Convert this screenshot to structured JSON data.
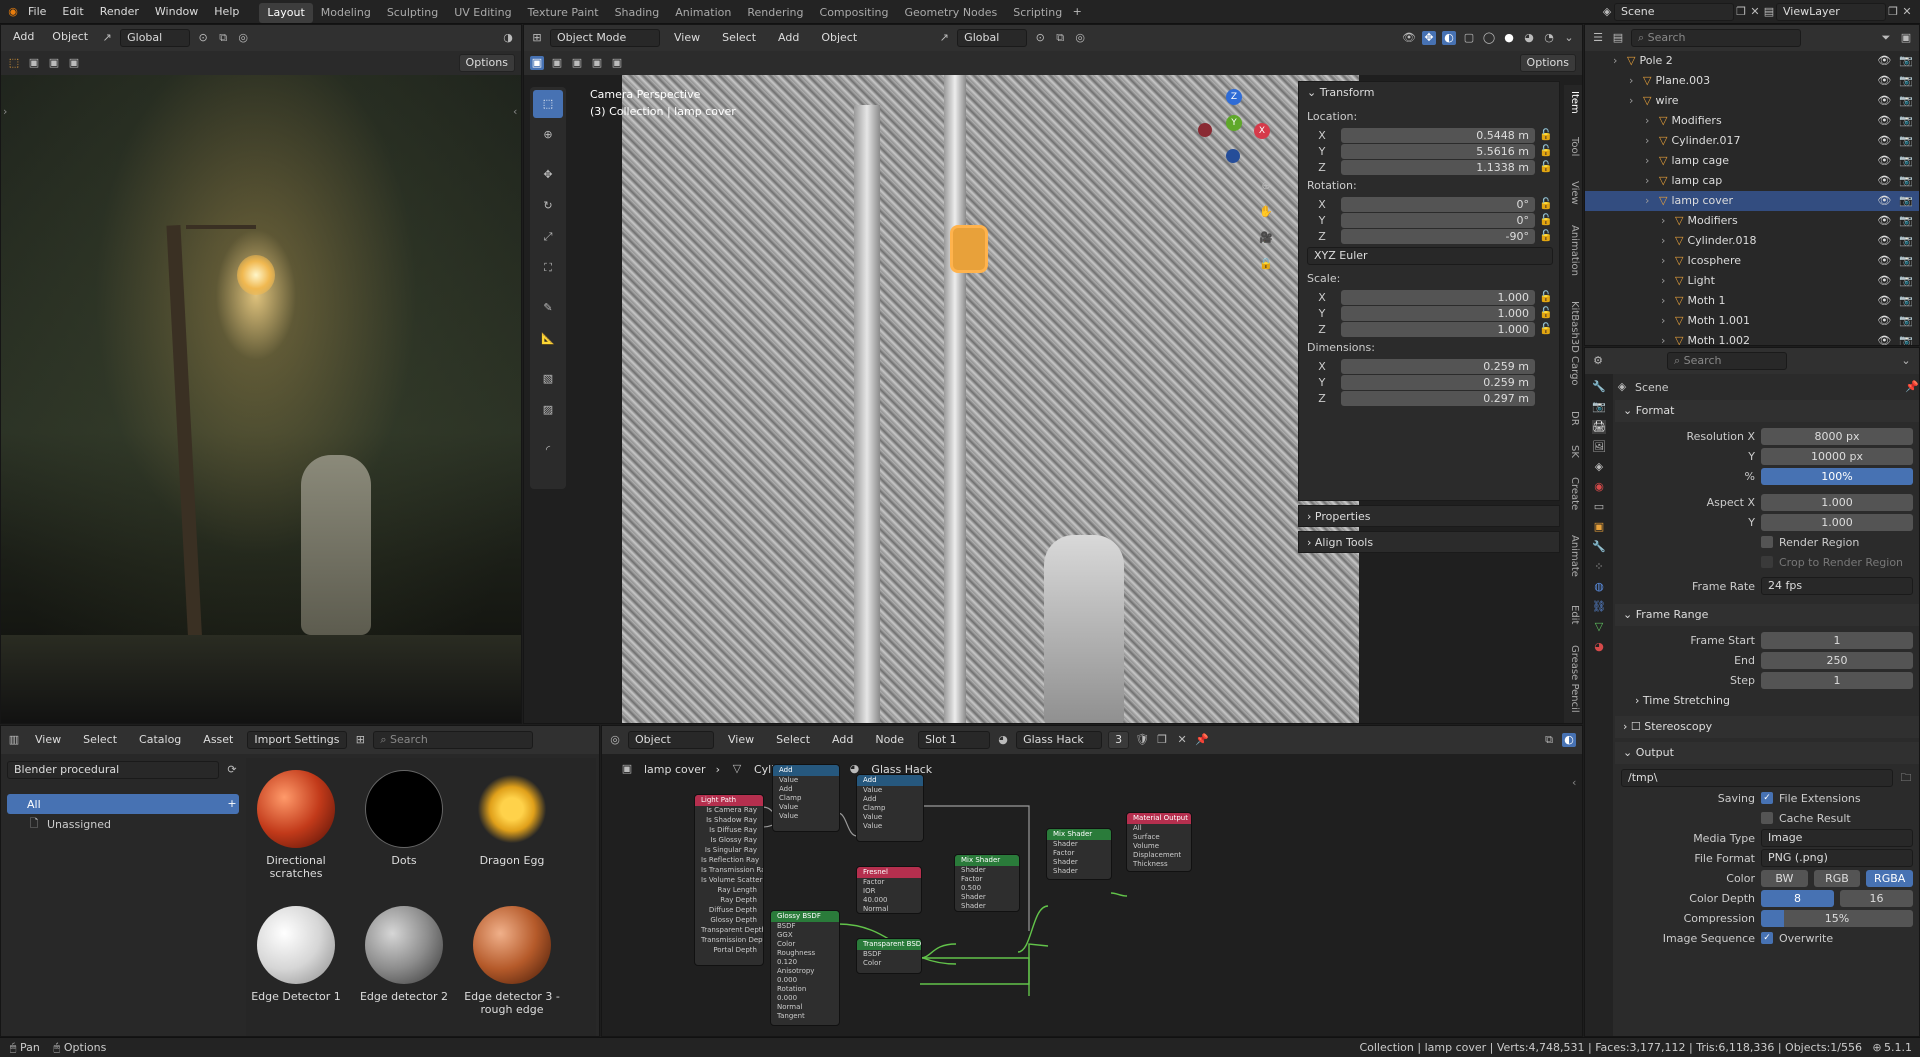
{
  "topbar": {
    "menus": [
      "File",
      "Edit",
      "Render",
      "Window",
      "Help"
    ],
    "workspaces": [
      "Layout",
      "Modeling",
      "Sculpting",
      "UV Editing",
      "Texture Paint",
      "Shading",
      "Animation",
      "Rendering",
      "Compositing",
      "Geometry Nodes",
      "Scripting"
    ],
    "active_workspace": "Layout",
    "scene": "Scene",
    "view_layer": "ViewLayer"
  },
  "render_view": {
    "menus": [
      "Add",
      "Object"
    ],
    "orientation": "Global",
    "options": "Options"
  },
  "viewport": {
    "mode": "Object Mode",
    "menus": [
      "View",
      "Select",
      "Add",
      "Object"
    ],
    "orientation": "Global",
    "options": "Options",
    "overlay_title": "Camera Perspective",
    "overlay_sub": "(3) Collection | lamp cover",
    "gizmo": {
      "x": "X",
      "y": "Y",
      "z": "Z"
    },
    "side_tabs": [
      "Item",
      "Tool",
      "View",
      "Animation",
      "KitBash3D Cargo",
      "DR",
      "SK",
      "Create",
      "Animate",
      "Edit",
      "Grease Pencil"
    ]
  },
  "npanel": {
    "transform": "Transform",
    "location_label": "Location:",
    "location": [
      {
        "axis": "X",
        "value": "0.5448 m"
      },
      {
        "axis": "Y",
        "value": "5.5616 m"
      },
      {
        "axis": "Z",
        "value": "1.1338 m"
      }
    ],
    "rotation_label": "Rotation:",
    "rotation": [
      {
        "axis": "X",
        "value": "0°"
      },
      {
        "axis": "Y",
        "value": "0°"
      },
      {
        "axis": "Z",
        "value": "-90°"
      }
    ],
    "rotation_mode": "XYZ Euler",
    "scale_label": "Scale:",
    "scale": [
      {
        "axis": "X",
        "value": "1.000"
      },
      {
        "axis": "Y",
        "value": "1.000"
      },
      {
        "axis": "Z",
        "value": "1.000"
      }
    ],
    "dimensions_label": "Dimensions:",
    "dimensions": [
      {
        "axis": "X",
        "value": "0.259 m"
      },
      {
        "axis": "Y",
        "value": "0.259 m"
      },
      {
        "axis": "Z",
        "value": "0.297 m"
      }
    ],
    "properties": "Properties",
    "align_tools": "Align Tools"
  },
  "outliner": {
    "search_placeholder": "Search",
    "items": [
      {
        "label": "Pole 2",
        "indent": 0
      },
      {
        "label": "Plane.003",
        "indent": 1
      },
      {
        "label": "wire",
        "indent": 1
      },
      {
        "label": "Modifiers",
        "indent": 2
      },
      {
        "label": "Cylinder.017",
        "indent": 2
      },
      {
        "label": "lamp cage",
        "indent": 2
      },
      {
        "label": "lamp cap",
        "indent": 2
      },
      {
        "label": "lamp cover",
        "indent": 2,
        "selected": true
      },
      {
        "label": "Modifiers",
        "indent": 3
      },
      {
        "label": "Cylinder.018",
        "indent": 3
      },
      {
        "label": "Icosphere",
        "indent": 3
      },
      {
        "label": "Light",
        "indent": 3
      },
      {
        "label": "Moth 1",
        "indent": 3
      },
      {
        "label": "Moth 1.001",
        "indent": 3
      },
      {
        "label": "Moth 1.002",
        "indent": 3
      }
    ]
  },
  "properties": {
    "search_placeholder": "Search",
    "scene": "Scene",
    "format": "Format",
    "rows": [
      {
        "label": "Resolution X",
        "value": "8000 px"
      },
      {
        "label": "Y",
        "value": "10000 px"
      },
      {
        "label": "%",
        "value": "100%"
      },
      {
        "label": "Aspect X",
        "value": "1.000"
      },
      {
        "label": "Y",
        "value": "1.000"
      }
    ],
    "render_region": "Render Region",
    "crop": "Crop to Render Region",
    "frame_rate_label": "Frame Rate",
    "frame_rate": "24 fps",
    "frame_range": "Frame Range",
    "frame_rows": [
      {
        "label": "Frame Start",
        "value": "1"
      },
      {
        "label": "End",
        "value": "250"
      },
      {
        "label": "Step",
        "value": "1"
      }
    ],
    "time_stretching": "Time Stretching",
    "stereoscopy": "Stereoscopy",
    "output": "Output",
    "output_path": "/tmp\\",
    "saving_label": "Saving",
    "file_extensions": "File Extensions",
    "cache_result": "Cache Result",
    "media_type_label": "Media Type",
    "media_type": "Image",
    "file_format_label": "File Format",
    "file_format": "PNG (.png)",
    "color_label": "Color",
    "color_opts": [
      "BW",
      "RGB",
      "RGBA"
    ],
    "color_depth_label": "Color Depth",
    "color_depth_opts": [
      "8",
      "16"
    ],
    "compression_label": "Compression",
    "compression": "15%",
    "image_sequence_label": "Image Sequence",
    "overwrite": "Overwrite"
  },
  "asset_browser": {
    "menus": [
      "View",
      "Select",
      "Catalog",
      "Asset"
    ],
    "import_settings": "Import Settings",
    "search_placeholder": "Search",
    "library": "Blender procedural",
    "catalog_all": "All",
    "catalog_unassigned": "Unassigned",
    "assets": [
      "Directional scratches",
      "Dots",
      "Dragon Egg",
      "Edge Detector 1",
      "Edge detector 2",
      "Edge detector 3 - rough edge"
    ]
  },
  "node_editor": {
    "object": "Object",
    "menus": [
      "View",
      "Select",
      "Add",
      "Node"
    ],
    "slot": "Slot 1",
    "material": "Glass Hack",
    "users": "3",
    "breadcrumb": [
      "lamp cover",
      "Cylinder.018",
      "Glass Hack"
    ],
    "nodes": {
      "light_path": {
        "title": "Light Path",
        "rows": [
          "Is Camera Ray",
          "Is Shadow Ray",
          "Is Diffuse Ray",
          "Is Glossy Ray",
          "Is Singular Ray",
          "Is Reflection Ray",
          "Is Transmission Ray",
          "Is Volume Scatter Ray",
          "Ray Length",
          "Ray Depth",
          "Diffuse Depth",
          "Glossy Depth",
          "Transparent Depth",
          "Transmission Depth",
          "Portal Depth"
        ]
      },
      "add1": {
        "title": "Add",
        "rows": [
          "Value",
          "Add",
          "Clamp",
          "Value",
          "Value"
        ]
      },
      "add2": {
        "title": "Add",
        "rows": [
          "Value",
          "Add",
          "Clamp",
          "Value",
          "Value"
        ]
      },
      "fresnel": {
        "title": "Fresnel",
        "rows": [
          "Factor",
          "IOR",
          "40.000",
          "Normal"
        ]
      },
      "glossy": {
        "title": "Glossy BSDF",
        "rows": [
          "BSDF",
          "GGX",
          "Color",
          "Roughness",
          "0.120",
          "Anisotropy",
          "0.000",
          "Rotation",
          "0.000",
          "Normal",
          "Tangent"
        ]
      },
      "transparent": {
        "title": "Transparent BSDF",
        "rows": [
          "BSDF",
          "Color"
        ]
      },
      "mix1": {
        "title": "Mix Shader",
        "rows": [
          "Shader",
          "Factor",
          "0.500",
          "Shader",
          "Shader"
        ]
      },
      "mix2": {
        "title": "Mix Shader",
        "rows": [
          "Shader",
          "Factor",
          "Shader",
          "Shader"
        ]
      },
      "output": {
        "title": "Material Output",
        "rows": [
          "All",
          "Surface",
          "Volume",
          "Displacement",
          "Thickness"
        ]
      }
    }
  },
  "statusbar": {
    "pan": "Pan",
    "options": "Options",
    "info": "Collection | lamp cover | Verts:4,748,531 | Faces:3,177,112 | Tris:6,118,336 | Objects:1/556",
    "version": "5.1.1"
  },
  "colors": {
    "accent": "#4772b3",
    "selected_row": "#334d80",
    "header": "#303030"
  }
}
